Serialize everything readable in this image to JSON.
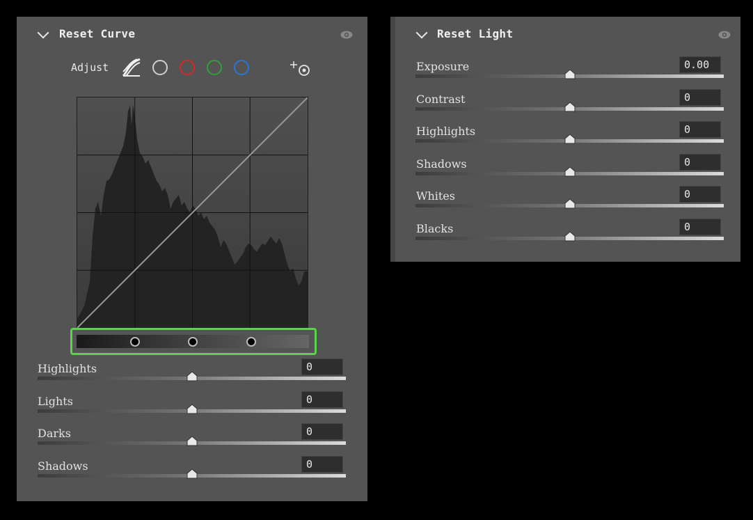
{
  "curve_panel": {
    "title": "Reset Curve",
    "adjust_label": "Adjust",
    "channel_colors": [
      "#cfcfcf",
      "#d62a2a",
      "#33a03a",
      "#2a76d6"
    ],
    "sliders": [
      {
        "label": "Highlights",
        "value": "0",
        "position": 0.5
      },
      {
        "label": "Lights",
        "value": "0",
        "position": 0.5
      },
      {
        "label": "Darks",
        "value": "0",
        "position": 0.5
      },
      {
        "label": "Shadows",
        "value": "0",
        "position": 0.5
      }
    ],
    "split_points": [
      0.25,
      0.5,
      0.75
    ],
    "accent_color": "#5ad34a"
  },
  "light_panel": {
    "title": "Reset Light",
    "sliders": [
      {
        "label": "Exposure",
        "value": "0.00",
        "position": 0.5
      },
      {
        "label": "Contrast",
        "value": "0",
        "position": 0.5
      },
      {
        "label": "Highlights",
        "value": "0",
        "position": 0.5
      },
      {
        "label": "Shadows",
        "value": "0",
        "position": 0.5
      },
      {
        "label": "Whites",
        "value": "0",
        "position": 0.5
      },
      {
        "label": "Blacks",
        "value": "0",
        "position": 0.5
      }
    ]
  },
  "icons": [
    "chevron-down-icon",
    "eye-icon",
    "parametric-curve-icon",
    "targeted-adjustment-icon",
    "thumb-icon"
  ]
}
